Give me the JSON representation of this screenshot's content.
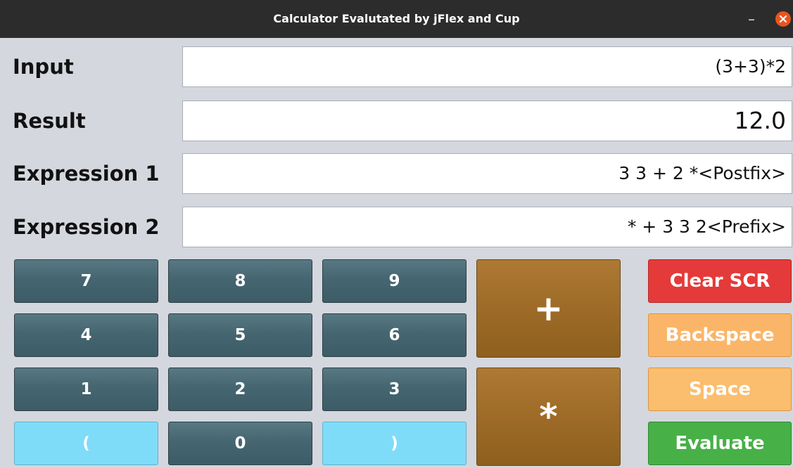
{
  "window": {
    "title": "Calculator Evalutated by jFlex and Cup"
  },
  "fields": {
    "input": {
      "label": "Input",
      "value": "(3+3)*2"
    },
    "result": {
      "label": "Result",
      "value": "12.0"
    },
    "expression1": {
      "label": "Expression 1",
      "value": "3 3 + 2 *<Postfix>"
    },
    "expression2": {
      "label": "Expression 2",
      "value": "* + 3 3 2<Prefix>"
    }
  },
  "keypad": {
    "k7": "7",
    "k8": "8",
    "k9": "9",
    "k4": "4",
    "k5": "5",
    "k6": "6",
    "k1": "1",
    "k2": "2",
    "k3": "3",
    "lparen": "(",
    "k0": "0",
    "rparen": ")",
    "plus": "+",
    "multiply": "*"
  },
  "actions": {
    "clear": "Clear SCR",
    "backspace": "Backspace",
    "space": "Space",
    "evaluate": "Evaluate"
  },
  "colors": {
    "number_button": "#456670",
    "paren_button": "#7fdcf8",
    "operator_button": "#9c6a26",
    "clear_button": "#e53a3a",
    "backspace_button": "#fbb568",
    "space_button": "#fbbd6e",
    "evaluate_button": "#47b047",
    "close_button": "#e95420"
  },
  "icons": {
    "minimize": "minimize-icon",
    "close": "close-icon"
  }
}
